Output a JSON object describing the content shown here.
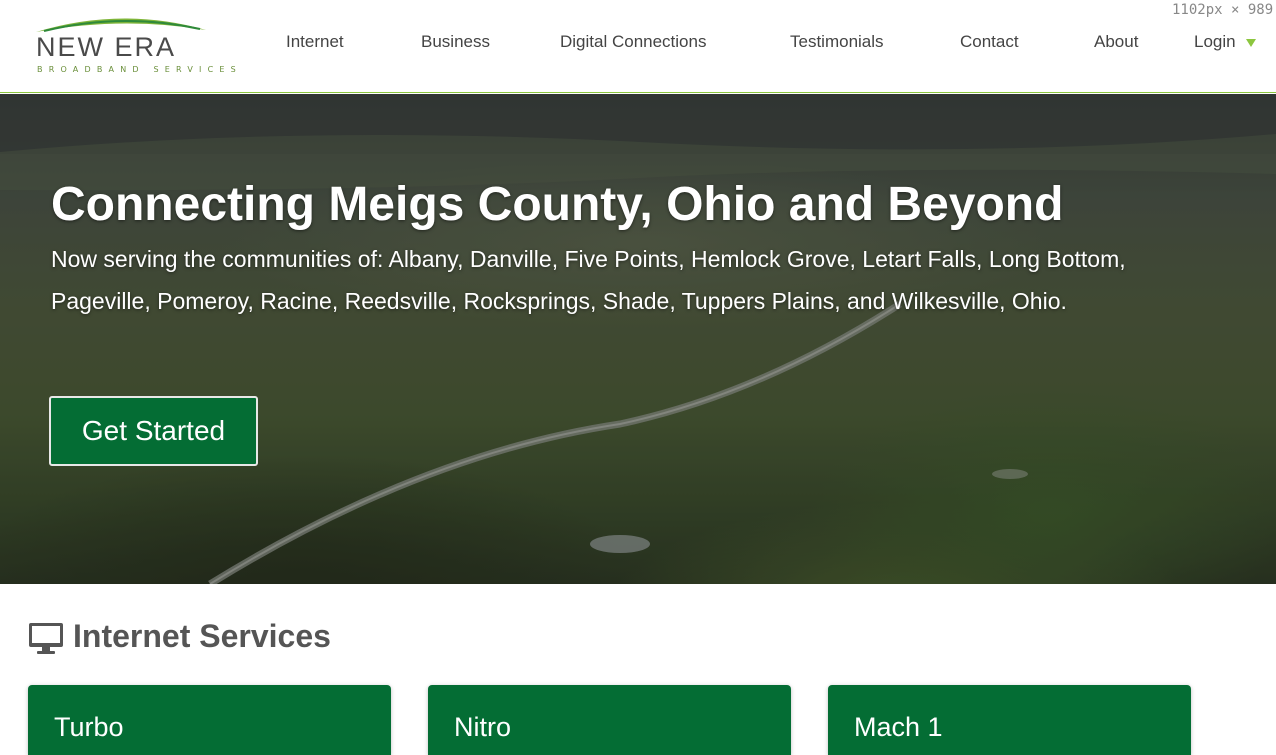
{
  "viewport_readout": "1102px × 989",
  "brand": {
    "name": "NEW ERA",
    "tagline": "BROADBAND SERVICES"
  },
  "nav": {
    "items": [
      {
        "label": "Internet"
      },
      {
        "label": "Business"
      },
      {
        "label": "Digital Connections"
      },
      {
        "label": "Testimonials"
      },
      {
        "label": "Contact"
      },
      {
        "label": "About"
      },
      {
        "label": "Login"
      }
    ]
  },
  "hero": {
    "title": "Connecting Meigs County, Ohio and Beyond",
    "text": "Now serving the communities of: Albany, Danville, Five Points, Hemlock Grove, Letart Falls, Long Bottom, Pageville, Pomeroy, Racine, Reedsville, Rocksprings, Shade, Tuppers Plains, and Wilkesville, Ohio.",
    "cta_label": "Get Started"
  },
  "services": {
    "title": "Internet Services",
    "plans": [
      {
        "name": "Turbo"
      },
      {
        "name": "Nitro"
      },
      {
        "name": "Mach 1"
      }
    ]
  },
  "colors": {
    "brand_green": "#046d34",
    "accent_lime": "#8cc63f"
  }
}
